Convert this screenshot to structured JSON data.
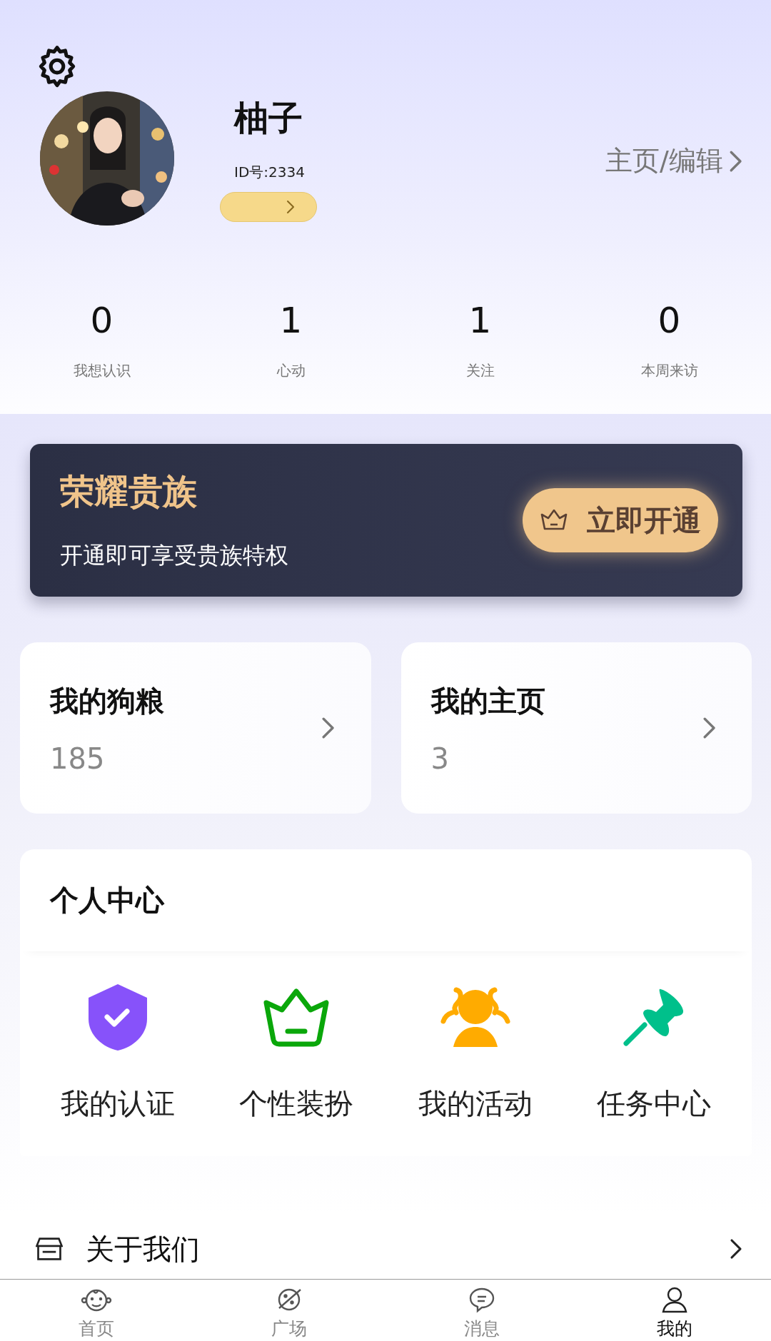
{
  "profile": {
    "name": "柚子",
    "id_label": "ID号:2334",
    "edit_link": "主页/编辑"
  },
  "stats": [
    {
      "value": "0",
      "label": "我想认识"
    },
    {
      "value": "1",
      "label": "心动"
    },
    {
      "value": "1",
      "label": "关注"
    },
    {
      "value": "0",
      "label": "本周来访"
    }
  ],
  "vip": {
    "title": "荣耀贵族",
    "subtitle": "开通即可享受贵族特权",
    "button": "立即开通"
  },
  "cards": [
    {
      "title": "我的狗粮",
      "value": "185"
    },
    {
      "title": "我的主页",
      "value": "3"
    }
  ],
  "personal_center": {
    "title": "个人中心",
    "items": [
      {
        "label": "我的认证",
        "kind": "shield",
        "color": "#8752fa"
      },
      {
        "label": "个性装扮",
        "kind": "crown",
        "color": "#0aa70a"
      },
      {
        "label": "我的活动",
        "kind": "group",
        "color": "#ffab00"
      },
      {
        "label": "任务中心",
        "kind": "pin",
        "color": "#00c08b"
      }
    ]
  },
  "about": {
    "label": "关于我们"
  },
  "tab_bar": [
    {
      "label": "首页",
      "kind": "baby",
      "selected": false
    },
    {
      "label": "广场",
      "kind": "planet",
      "selected": false
    },
    {
      "label": "消息",
      "kind": "chat",
      "selected": false
    },
    {
      "label": "我的",
      "kind": "user",
      "selected": true
    }
  ]
}
